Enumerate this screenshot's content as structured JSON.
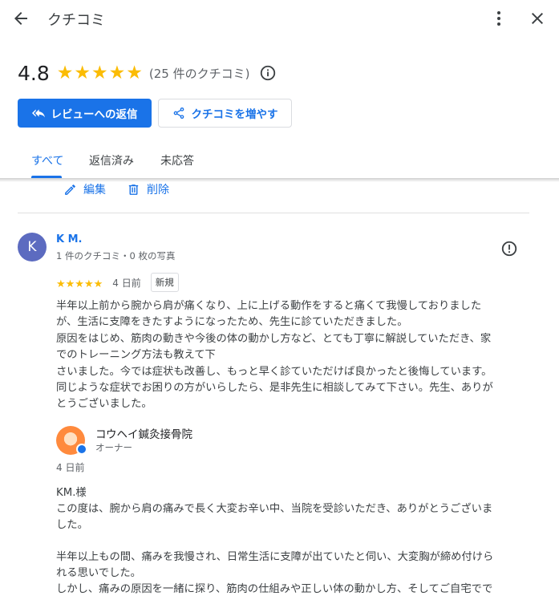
{
  "header": {
    "title": "クチコミ"
  },
  "summary": {
    "rating": "4.8",
    "stars": [
      "★",
      "★",
      "★",
      "★",
      "★"
    ],
    "review_count": "(25 件のクチコミ)"
  },
  "actions": {
    "reply_label": "レビューへの返信",
    "more_reviews_label": "クチコミを増やす"
  },
  "tabs": [
    {
      "label": "すべて"
    },
    {
      "label": "返信済み"
    },
    {
      "label": "未応答"
    }
  ],
  "previous_review_actions": {
    "edit": "編集",
    "delete": "削除"
  },
  "review": {
    "avatar_letter": "K",
    "author": "K M.",
    "meta": "1 件のクチコミ・0 枚の写真",
    "stars": "★★★★★",
    "date": "4 日前",
    "badge": "新規",
    "text": "半年以上前から腕から肩が痛くなり、上に上げる動作をすると痛くて我慢しておりました\nが、生活に支障をきたすようになったため、先生に診ていただきました。\n原因をはじめ、筋肉の動きや今後の体の動かし方など、とても丁寧に解説していただき、家\nでのトレーニング方法も教えて下\nさいました。今では症状も改善し、もっと早く診ていただけば良かったと後悔しています。\n同じような症状でお困りの方がいらしたら、是非先生に相談してみて下さい。先生、ありが\nとうございました。"
  },
  "owner_reply": {
    "name": "コウヘイ鍼灸接骨院",
    "role": "オーナー",
    "date": "4 日前",
    "text": "KM.様\nこの度は、腕から肩の痛みで長く大変お辛い中、当院を受診いただき、ありがとうございま\nした。\n\n半年以上もの間、痛みを我慢され、日常生活に支障が出ていたと伺い、大変胸が締め付けら\nれる思いでした。\nしかし、痛みの原因を一緒に探り、筋肉の仕組みや正しい体の動かし方、そしてご自宅でで"
  },
  "colors": {
    "accent": "#1a73e8",
    "star": "#fbbc04",
    "avatar": "#5c6bc0"
  }
}
